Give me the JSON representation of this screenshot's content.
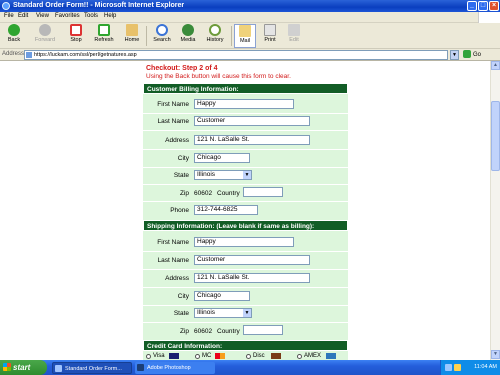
{
  "window": {
    "title": "Standard Order Form!! - Microsoft Internet Explorer"
  },
  "menu": [
    "File",
    "Edit",
    "View",
    "Favorites",
    "Tools",
    "Help"
  ],
  "toolbar": {
    "back": "Back",
    "forward": "Forward",
    "stop": "Stop",
    "refresh": "Refresh",
    "home": "Home",
    "search": "Search",
    "media": "Media",
    "history": "History",
    "mail": "Mail",
    "print": "Print",
    "edit": "Edit"
  },
  "address": {
    "label": "Address",
    "url": "https://luckam.com/ssl/perl/getnatures.asp",
    "go": "Go"
  },
  "page": {
    "checkout": "Checkout: Step 2 of 4",
    "back_note": "Using the Back button will cause this form to clear."
  },
  "billing": {
    "header": "Customer Billing Information:",
    "first_name_label": "First Name",
    "first_name": "Happy",
    "last_name_label": "Last Name",
    "last_name": "Customer",
    "address_label": "Address",
    "address": "121 N. LaSalle St.",
    "city_label": "City",
    "city": "Chicago",
    "state_label": "State",
    "state": "Illinois",
    "zip_label": "Zip",
    "zip": "60602",
    "country_label": "Country",
    "country": "",
    "phone_label": "Phone",
    "phone": "312-744-6825"
  },
  "shipping": {
    "header": "Shipping Information: (Leave blank if same as billing):",
    "first_name_label": "First Name",
    "first_name": "Happy",
    "last_name_label": "Last Name",
    "last_name": "Customer",
    "address_label": "Address",
    "address": "121 N. LaSalle St.",
    "city_label": "City",
    "city": "Chicago",
    "state_label": "State",
    "state": "Illinois",
    "zip_label": "Zip",
    "zip": "60602",
    "country_label": "Country",
    "country": ""
  },
  "credit": {
    "header": "Credit Card Information:",
    "options": [
      "Visa",
      "MC",
      "Disc",
      "AMEX"
    ]
  },
  "taskbar": {
    "start": "start",
    "tasks": [
      "Standard Order Form...",
      "Adobe Photoshop"
    ],
    "clock": "11:04 AM"
  }
}
